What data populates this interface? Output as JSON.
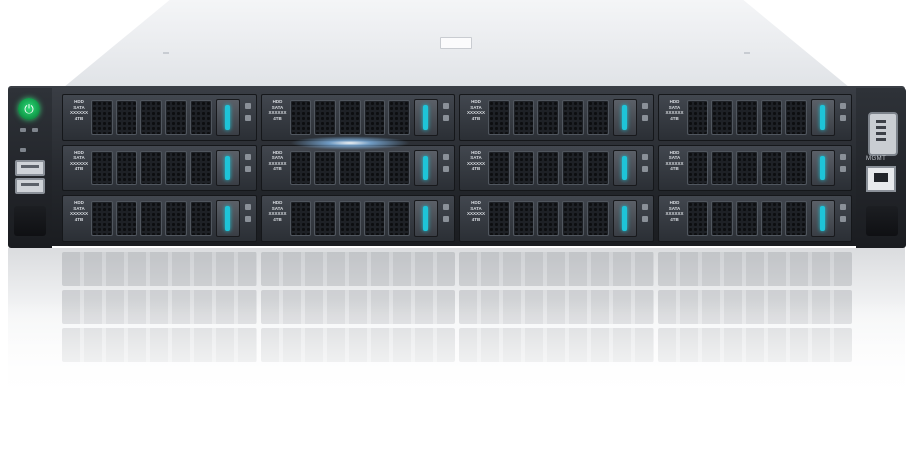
{
  "product": {
    "drive_label": "HDD\nSATA\nXXXXXX\n4TB",
    "drive_count": 12,
    "front_port_labels": {
      "mgmt": "MGMT"
    },
    "accent_colors": {
      "drive_led": "#1ec4d8",
      "power_led": "#2fdc7a"
    },
    "icons": [
      "power-icon",
      "usb-icon",
      "vga-port-icon",
      "rj45-port-icon"
    ]
  }
}
